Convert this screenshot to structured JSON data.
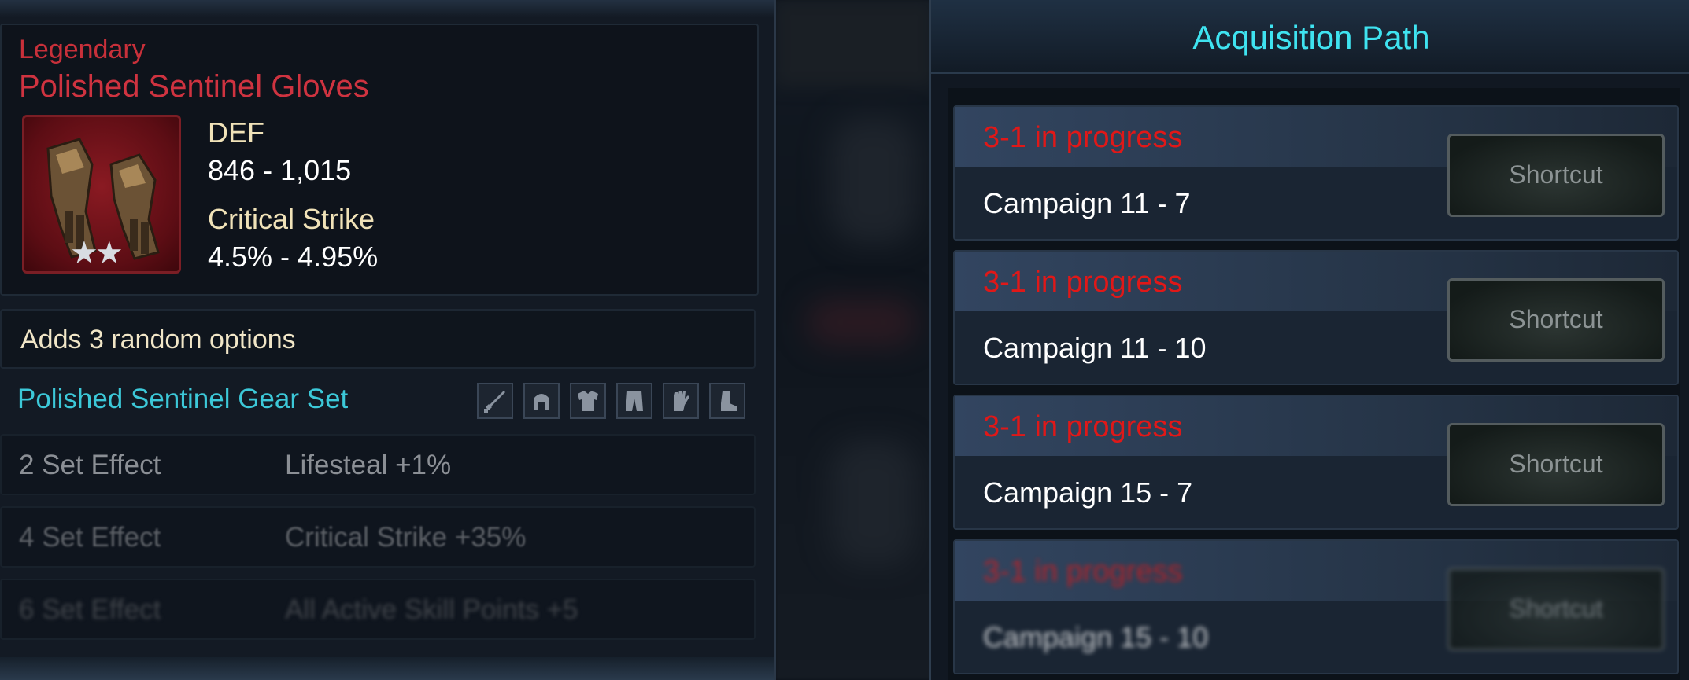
{
  "item": {
    "rarity": "Legendary",
    "name": "Polished Sentinel Gloves",
    "icon": "gauntlets-icon",
    "stars": "★★",
    "stats": [
      {
        "label": "DEF",
        "value": "846  - 1,015"
      },
      {
        "label": "Critical Strike",
        "value": "4.5%  - 4.95%"
      }
    ],
    "options_text": "Adds 3 random options"
  },
  "gear_set": {
    "name": "Polished Sentinel Gear Set",
    "piece_icons": [
      "sword-icon",
      "helmet-icon",
      "armor-icon",
      "pants-icon",
      "gloves-icon",
      "boots-icon"
    ],
    "effects": [
      {
        "count": "2 Set Effect",
        "effect": "Lifesteal +1%"
      },
      {
        "count": "4 Set Effect",
        "effect": "Critical Strike +35%"
      },
      {
        "count": "6 Set Effect",
        "effect": "All Active Skill Points +5"
      }
    ]
  },
  "acquisition": {
    "title": "Acquisition Path",
    "paths": [
      {
        "status": "3-1 in progress",
        "stage": "Campaign 11 - 7",
        "button": "Shortcut"
      },
      {
        "status": "3-1 in progress",
        "stage": "Campaign 11 - 10",
        "button": "Shortcut"
      },
      {
        "status": "3-1 in progress",
        "stage": "Campaign 15 - 7",
        "button": "Shortcut"
      },
      {
        "status": "3-1 in progress",
        "stage": "Campaign 15 - 10",
        "button": "Shortcut"
      }
    ]
  },
  "colors": {
    "rarity_legendary": "#cf3340",
    "set_name": "#3cc8d8",
    "title_cyan": "#3fe3f0",
    "status_red": "#e01818"
  }
}
